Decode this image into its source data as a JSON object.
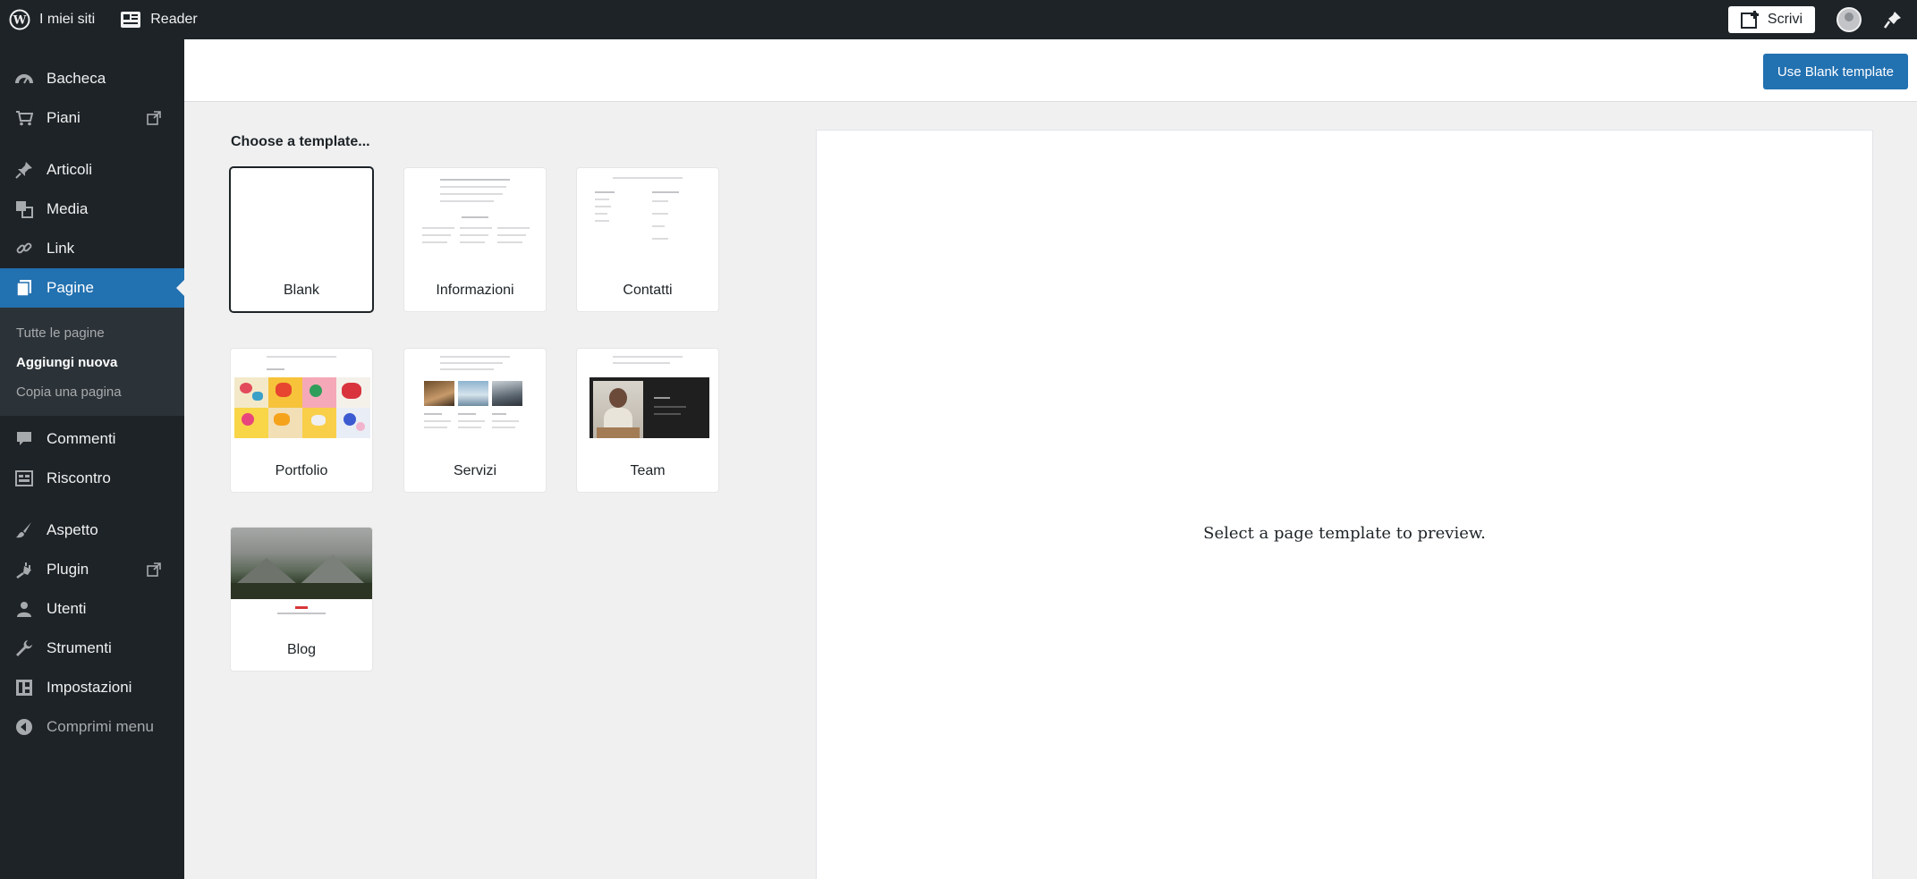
{
  "adminbar": {
    "sites_label": "I miei siti",
    "reader_label": "Reader",
    "write_label": "Scrivi",
    "icons": [
      "wordpress-icon",
      "reader-icon",
      "write-icon",
      "avatar",
      "notifications-icon"
    ]
  },
  "sidebar": {
    "items": [
      {
        "label": "Bacheca",
        "icon": "dashboard-icon"
      },
      {
        "label": "Piani",
        "icon": "cart-icon",
        "external": true
      },
      {
        "label": "Articoli",
        "icon": "pin-icon"
      },
      {
        "label": "Media",
        "icon": "media-icon"
      },
      {
        "label": "Link",
        "icon": "link-icon"
      },
      {
        "label": "Pagine",
        "icon": "pages-icon",
        "active": true
      },
      {
        "label": "Commenti",
        "icon": "comment-icon"
      },
      {
        "label": "Riscontro",
        "icon": "feedback-icon"
      },
      {
        "label": "Aspetto",
        "icon": "brush-icon"
      },
      {
        "label": "Plugin",
        "icon": "plugin-icon",
        "external": true
      },
      {
        "label": "Utenti",
        "icon": "users-icon"
      },
      {
        "label": "Strumenti",
        "icon": "wrench-icon"
      },
      {
        "label": "Impostazioni",
        "icon": "settings-icon"
      },
      {
        "label": "Comprimi menu",
        "icon": "collapse-icon"
      }
    ],
    "submenu": [
      "Tutte le pagine",
      "Aggiungi nuova",
      "Copia una pagina"
    ]
  },
  "toolbar": {
    "use_blank_label": "Use Blank template"
  },
  "chooser": {
    "title": "Choose a template...",
    "templates": [
      "Blank",
      "Informazioni",
      "Contatti",
      "Portfolio",
      "Servizi",
      "Team",
      "Blog"
    ],
    "selected": "Blank"
  },
  "preview": {
    "message": "Select a page template to preview."
  },
  "colors": {
    "admin_dark": "#1d2327",
    "accent": "#2271b1",
    "background": "#f0f0f1"
  }
}
